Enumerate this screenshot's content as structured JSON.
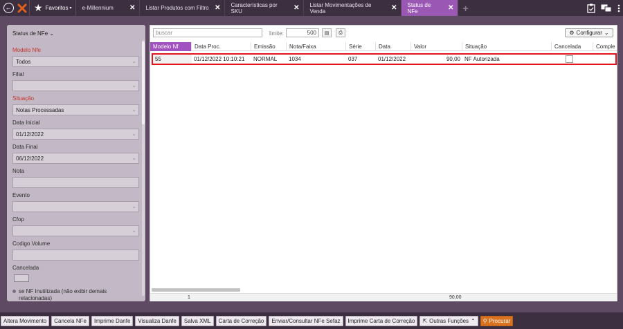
{
  "topbar": {
    "favorites_label": "Favoritos",
    "tabs": [
      {
        "label": "e-Millennium",
        "active": false
      },
      {
        "label": "Listar Produtos com Filtro",
        "active": false
      },
      {
        "label": "Características por SKU",
        "active": false
      },
      {
        "label": "Listar Movimentações de Venda",
        "active": false
      },
      {
        "label": "Status de NFe",
        "active": true
      }
    ],
    "accent_color": "#9a58b4"
  },
  "filters": {
    "panel_title": "Status de NFe",
    "modelo_label": "Modelo Nfe",
    "modelo_value": "Todos",
    "filial_label": "Filial",
    "filial_value": "",
    "situacao_label": "Situação",
    "situacao_value": "Notas Processadas",
    "data_inicial_label": "Data Inicial",
    "data_inicial_value": "01/12/2022",
    "data_final_label": "Data Final",
    "data_final_value": "06/12/2022",
    "nota_label": "Nota",
    "evento_label": "Evento",
    "cfop_label": "Cfop",
    "codigo_volume_label": "Codigo Volume",
    "cancelada_label": "Cancelada",
    "inutilizada_note": "se NF Inutilizada (não exibir demais relacionadas)"
  },
  "grid": {
    "search_placeholder": "buscar",
    "limit_label": "limite:",
    "limit_value": "500",
    "configure_label": "Configurar",
    "columns": [
      "Modelo Nf",
      "Data Proc.",
      "Emissão",
      "Nota/Faixa",
      "Série",
      "Data",
      "Valor",
      "Situação",
      "Cancelada",
      "Comple"
    ],
    "rows": [
      {
        "modelo": "55",
        "data_proc": "01/12/2022 10:10:21",
        "emissao": "NORMAL",
        "nota": "1034",
        "serie": "037",
        "data": "01/12/2022",
        "valor": "90,00",
        "situacao": "NF Autorizada"
      }
    ],
    "footer_count": "1",
    "footer_total": "90,00"
  },
  "actions": {
    "buttons": [
      "Altera Movimento",
      "Cancela NFe",
      "Imprime Danfe",
      "Visualiza Danfe",
      "Salva XML",
      "Carta de Correção",
      "Enviar/Consultar NFe Sefaz",
      "Imprime Carta de Correção"
    ],
    "outras_label": "Outras Funções",
    "procurar_label": "Procurar"
  }
}
